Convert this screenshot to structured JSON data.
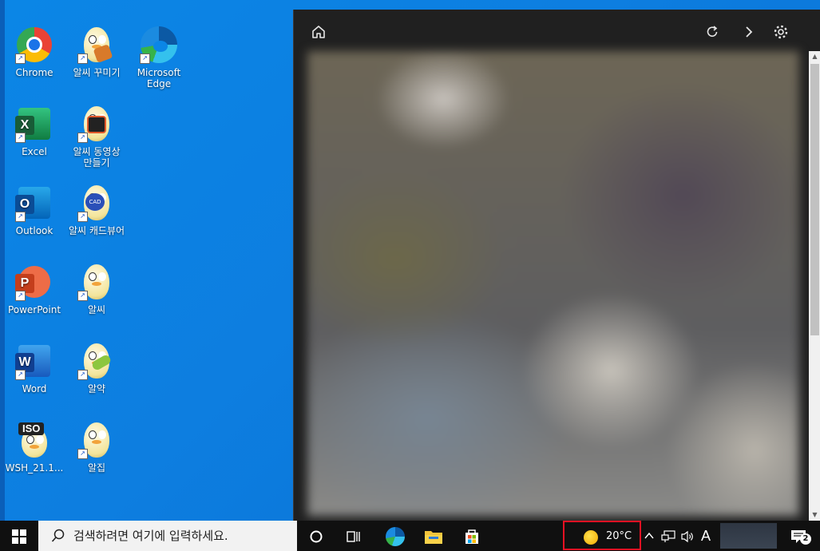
{
  "desktop": {
    "icons": [
      {
        "label": "Chrome",
        "type": "chrome"
      },
      {
        "label": "알씨 꾸미기",
        "type": "egg"
      },
      {
        "label": "Microsoft Edge",
        "type": "edge"
      },
      {
        "label": "Excel",
        "type": "excel",
        "badge": "X"
      },
      {
        "label": "알씨 동영상 만들기",
        "type": "egg"
      },
      {
        "label": "Outlook",
        "type": "outlook",
        "badge": "O"
      },
      {
        "label": "알씨 캐드뷰어",
        "type": "egg",
        "badge": "CAD"
      },
      {
        "label": "PowerPoint",
        "type": "ppt",
        "badge": "P"
      },
      {
        "label": "알씨",
        "type": "egg"
      },
      {
        "label": "Word",
        "type": "word",
        "badge": "W"
      },
      {
        "label": "알약",
        "type": "egg"
      },
      {
        "label": "WSH_21.1...",
        "type": "egg",
        "badge": "ISO"
      },
      {
        "label": "알집",
        "type": "egg"
      }
    ]
  },
  "widget": {
    "home_icon": "home-icon",
    "refresh_icon": "refresh-icon",
    "next_icon": "chevron-right-icon",
    "settings_icon": "gear-icon"
  },
  "taskbar": {
    "search_placeholder": "검색하려면 여기에 입력하세요.",
    "weather_temp": "20°C",
    "input_indicator": "A",
    "notification_count": "2"
  }
}
